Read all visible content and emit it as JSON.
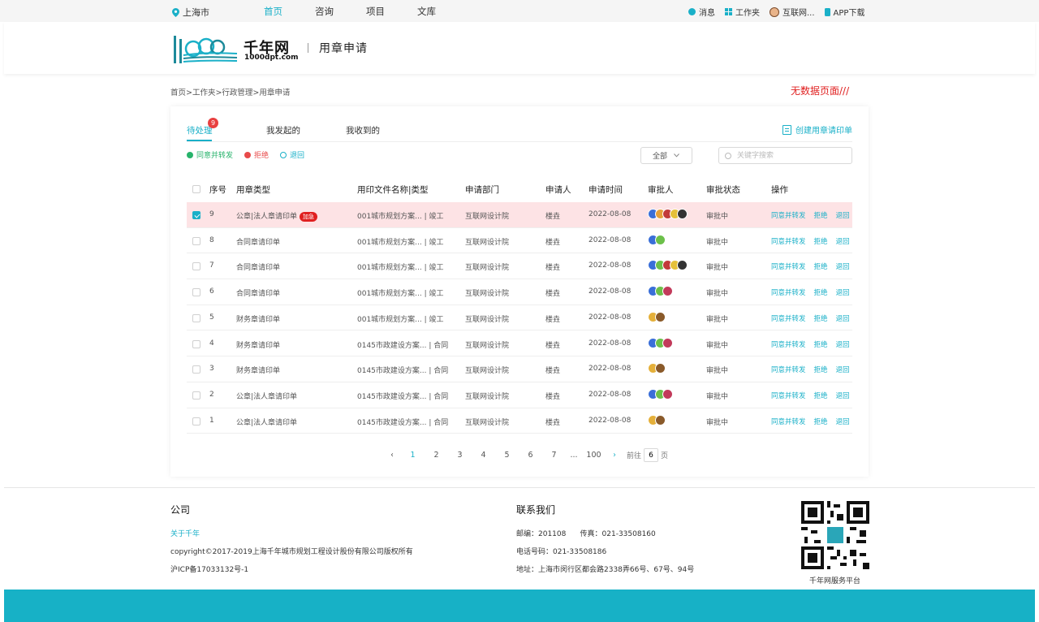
{
  "topbar": {
    "location": "上海市",
    "nav": [
      "首页",
      "咨询",
      "项目",
      "文库"
    ],
    "messages": "消息",
    "workspace": "工作夹",
    "user": "互联网...",
    "app": "APP下载"
  },
  "header": {
    "logo_text": "千年网",
    "logo_sub": "1000dpt.com",
    "title": "用章申请"
  },
  "breadcrumb": "首页>工作夹>行政管理>用章申请",
  "annotation": "无数据页面///",
  "tabs": [
    {
      "label": "待处理",
      "badge": "9"
    },
    {
      "label": "我发起的"
    },
    {
      "label": "我收到的"
    }
  ],
  "create_label": "创建用章请印单",
  "actions": {
    "agree": "同意并转发",
    "reject": "拒绝",
    "return": "退回"
  },
  "filter": {
    "selected": "全部"
  },
  "search": {
    "placeholder": "关键字搜索"
  },
  "columns": [
    "序号",
    "用章类型",
    "用印文件名称|类型",
    "申请部门",
    "申请人",
    "申请时间",
    "审批人",
    "审批状态",
    "操作"
  ],
  "rows": [
    {
      "no": "9",
      "type": "公章|法人章请印单",
      "urgent": "加急",
      "file": "001城市规划方案... | 竣工",
      "dept": "互联网设计院",
      "applicant": "楼垚",
      "date": "2022-08-08",
      "status": "审批中",
      "approvers": [
        "#3a6fd8",
        "#e5a03a",
        "#c23a3a",
        "#e5c03a",
        "#333333"
      ],
      "selected": true
    },
    {
      "no": "8",
      "type": "合同章请印单",
      "file": "001城市规划方案... | 竣工",
      "dept": "互联网设计院",
      "applicant": "楼垚",
      "date": "2022-08-08",
      "status": "审批中",
      "approvers": [
        "#3a6fd8",
        "#6cc04a"
      ]
    },
    {
      "no": "7",
      "type": "合同章请印单",
      "file": "001城市规划方案... | 竣工",
      "dept": "互联网设计院",
      "applicant": "楼垚",
      "date": "2022-08-08",
      "status": "审批中",
      "approvers": [
        "#3a6fd8",
        "#6cc04a",
        "#c23a3a",
        "#e5c03a",
        "#333333"
      ]
    },
    {
      "no": "6",
      "type": "合同章请印单",
      "file": "001城市规划方案... | 竣工",
      "dept": "互联网设计院",
      "applicant": "楼垚",
      "date": "2022-08-08",
      "status": "审批中",
      "approvers": [
        "#3a6fd8",
        "#6cc04a",
        "#c23a5a"
      ]
    },
    {
      "no": "5",
      "type": "财务章请印单",
      "file": "001城市规划方案... | 竣工",
      "dept": "互联网设计院",
      "applicant": "楼垚",
      "date": "2022-08-08",
      "status": "审批中",
      "approvers": [
        "#e5b03a",
        "#8a5a2a"
      ]
    },
    {
      "no": "4",
      "type": "财务章请印单",
      "file": "0145市政建设方案... | 合同",
      "dept": "互联网设计院",
      "applicant": "楼垚",
      "date": "2022-08-08",
      "status": "审批中",
      "approvers": [
        "#3a6fd8",
        "#6cc04a",
        "#c23a5a"
      ]
    },
    {
      "no": "3",
      "type": "财务章请印单",
      "file": "0145市政建设方案... | 合同",
      "dept": "互联网设计院",
      "applicant": "楼垚",
      "date": "2022-08-08",
      "status": "审批中",
      "approvers": [
        "#e5b03a",
        "#8a5a2a"
      ]
    },
    {
      "no": "2",
      "type": "公章|法人章请印单",
      "file": "0145市政建设方案... | 合同",
      "dept": "互联网设计院",
      "applicant": "楼垚",
      "date": "2022-08-08",
      "status": "审批中",
      "approvers": [
        "#3a6fd8",
        "#6cc04a",
        "#c23a5a"
      ]
    },
    {
      "no": "1",
      "type": "公章|法人章请印单",
      "file": "0145市政建设方案... | 合同",
      "dept": "互联网设计院",
      "applicant": "楼垚",
      "date": "2022-08-08",
      "status": "审批中",
      "approvers": [
        "#e5b03a",
        "#8a5a2a"
      ]
    }
  ],
  "row_ops": [
    "同意并转发",
    "拒绝",
    "退回"
  ],
  "pagination": {
    "prev": "‹",
    "pages": [
      "1",
      "2",
      "3",
      "4",
      "5",
      "6",
      "7",
      "...",
      "100"
    ],
    "current": "1",
    "next": "›",
    "goto_label": "前往",
    "goto_value": "6",
    "goto_suffix": "页"
  },
  "footer": {
    "company_title": "公司",
    "about": "关于千年",
    "copyright": "copyright©2017-2019上海千年城市规划工程设计股份有限公司版权所有",
    "icp": "沪ICP备17033132号-1",
    "contact_title": "联系我们",
    "postcode": "邮编：201108      传真：021-33508160",
    "phone": "电话号码：021-33508186",
    "address": "地址：上海市闵行区都会路2338弄66号、67号、94号",
    "qr_caption": "千年网服务平台"
  },
  "colors": {
    "accent": "#1ab0c8",
    "urgent": "#e02020",
    "selected_row": "#fde3e5"
  }
}
